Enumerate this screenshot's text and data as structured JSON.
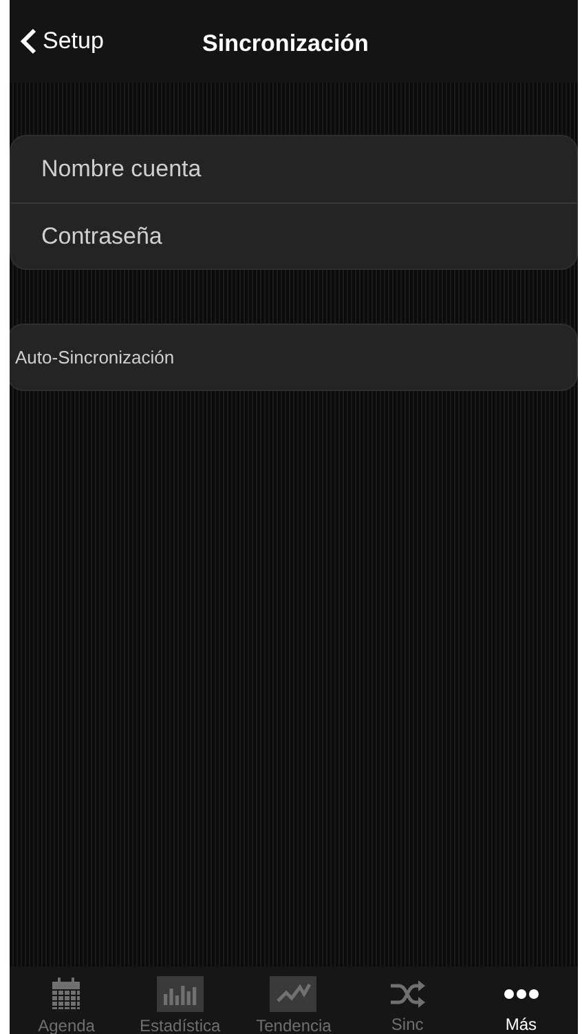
{
  "nav": {
    "back": "Setup",
    "title": "Sincronización"
  },
  "account_group": [
    {
      "label": "Nombre cuenta"
    },
    {
      "label": "Contraseña"
    }
  ],
  "auto_sync": {
    "label": "Auto-Sincronización"
  },
  "tab_bar": [
    {
      "kind": "calendar",
      "label": "Agenda",
      "selected": false
    },
    {
      "kind": "bars",
      "label": "Estadística",
      "selected": false
    },
    {
      "kind": "trend",
      "label": "Tendencia",
      "selected": false
    },
    {
      "kind": "shuffle",
      "label": "Sinc",
      "selected": false
    },
    {
      "kind": "dots",
      "label": "Más",
      "selected": true
    }
  ]
}
